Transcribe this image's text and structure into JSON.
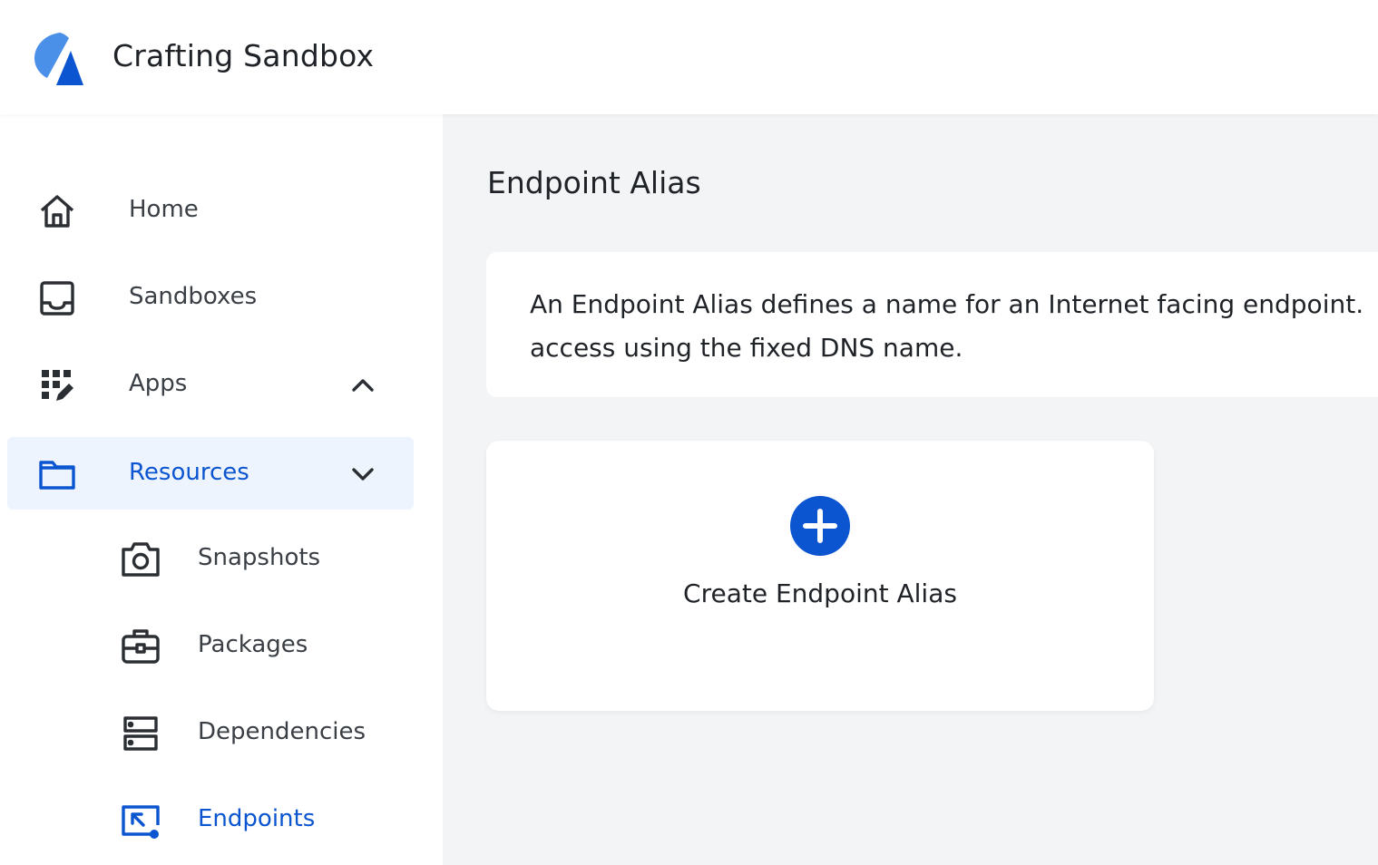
{
  "header": {
    "app_title": "Crafting Sandbox"
  },
  "sidebar": {
    "items": [
      {
        "label": "Home",
        "icon": "home-icon"
      },
      {
        "label": "Sandboxes",
        "icon": "inbox-icon"
      },
      {
        "label": "Apps",
        "icon": "apps-grid-icon",
        "expander": "chevron-up-icon"
      },
      {
        "label": "Resources",
        "icon": "folder-icon",
        "expander": "chevron-down-icon",
        "active": true
      }
    ],
    "sub_items": [
      {
        "label": "Snapshots",
        "icon": "camera-icon"
      },
      {
        "label": "Packages",
        "icon": "toolbox-icon"
      },
      {
        "label": "Dependencies",
        "icon": "server-icon"
      },
      {
        "label": "Endpoints",
        "icon": "endpoint-icon",
        "active": true
      }
    ]
  },
  "main": {
    "page_title": "Endpoint Alias",
    "info_text": "An Endpoint Alias defines a name for an Internet facing endpoint. access using the fixed DNS name.",
    "create_label": "Create Endpoint Alias"
  },
  "colors": {
    "accent": "#0b56d0",
    "active_bg": "#eef4fd",
    "main_bg": "#f3f4f6",
    "logo_light": "#4a90e8",
    "logo_dark": "#0b56d0"
  }
}
